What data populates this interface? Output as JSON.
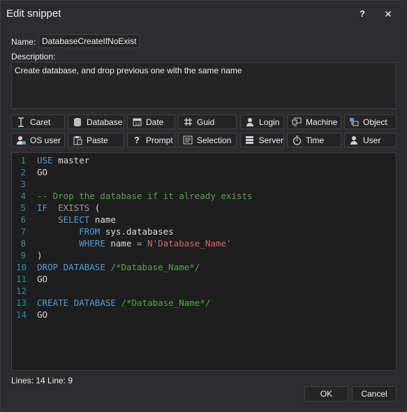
{
  "window": {
    "title": "Edit snippet",
    "help_label": "?",
    "close_label": "✕"
  },
  "form": {
    "name_label": "Name:",
    "name_value": "DatabaseCreateIfNoExist",
    "description_label": "Description:",
    "description_value": "Create database, and drop previous one with the same name"
  },
  "snippet_buttons": [
    {
      "label": "Caret",
      "icon": "caret-icon"
    },
    {
      "label": "Database",
      "icon": "database-icon"
    },
    {
      "label": "Date",
      "icon": "calendar-icon"
    },
    {
      "label": "Guid",
      "icon": "hash-icon"
    },
    {
      "label": "Login",
      "icon": "user-icon"
    },
    {
      "label": "Machine",
      "icon": "machine-icon"
    },
    {
      "label": "Object",
      "icon": "object-icon"
    },
    {
      "label": "OS user",
      "icon": "os-user-icon"
    },
    {
      "label": "Paste",
      "icon": "paste-icon"
    },
    {
      "label": "Prompt",
      "icon": "question-icon"
    },
    {
      "label": "Selection",
      "icon": "selection-icon"
    },
    {
      "label": "Server",
      "icon": "server-icon"
    },
    {
      "label": "Time",
      "icon": "stopwatch-icon"
    },
    {
      "label": "User",
      "icon": "user-icon"
    }
  ],
  "editor": {
    "lines": [
      {
        "num": "1",
        "parts": [
          [
            "kw",
            "USE"
          ],
          [
            "tx",
            " master"
          ]
        ]
      },
      {
        "num": "2",
        "parts": [
          [
            "tx",
            "GO"
          ]
        ]
      },
      {
        "num": "3",
        "parts": []
      },
      {
        "num": "4",
        "parts": [
          [
            "cm",
            "-- Drop the database if it already exists"
          ]
        ]
      },
      {
        "num": "5",
        "parts": [
          [
            "kw",
            "IF"
          ],
          [
            "tx",
            "  "
          ],
          [
            "gr",
            "EXISTS"
          ],
          [
            "tx",
            " ("
          ]
        ]
      },
      {
        "num": "6",
        "parts": [
          [
            "tx",
            "    "
          ],
          [
            "kw",
            "SELECT"
          ],
          [
            "tx",
            " name"
          ]
        ]
      },
      {
        "num": "7",
        "parts": [
          [
            "tx",
            "        "
          ],
          [
            "kw",
            "FROM"
          ],
          [
            "tx",
            " sys.databases"
          ]
        ]
      },
      {
        "num": "8",
        "parts": [
          [
            "tx",
            "        "
          ],
          [
            "kw",
            "WHERE"
          ],
          [
            "tx",
            " name "
          ],
          [
            "op",
            "="
          ],
          [
            "tx",
            " "
          ],
          [
            "st",
            "N'Database_Name'"
          ]
        ]
      },
      {
        "num": "9",
        "parts": [
          [
            "tx",
            ")"
          ]
        ]
      },
      {
        "num": "10",
        "parts": [
          [
            "kw",
            "DROP"
          ],
          [
            "tx",
            " "
          ],
          [
            "kw",
            "DATABASE"
          ],
          [
            "tx",
            " "
          ],
          [
            "cm",
            "/*Database_Name*/"
          ]
        ]
      },
      {
        "num": "11",
        "parts": [
          [
            "tx",
            "GO"
          ]
        ]
      },
      {
        "num": "12",
        "parts": []
      },
      {
        "num": "13",
        "parts": [
          [
            "kw",
            "CREATE"
          ],
          [
            "tx",
            " "
          ],
          [
            "kw",
            "DATABASE"
          ],
          [
            "tx",
            " "
          ],
          [
            "cm",
            "/*Database_Name*/"
          ]
        ]
      },
      {
        "num": "14",
        "parts": [
          [
            "tx",
            "GO"
          ]
        ]
      }
    ]
  },
  "status": {
    "text": "Lines: 14 Line: 9"
  },
  "footer": {
    "ok_label": "OK",
    "cancel_label": "Cancel"
  },
  "colors": {
    "background": "#2d2d30",
    "editor_background": "#1e1e1e",
    "keyword": "#569cd6",
    "comment": "#57a64a",
    "string": "#d16969",
    "line_number": "#2b91af"
  }
}
